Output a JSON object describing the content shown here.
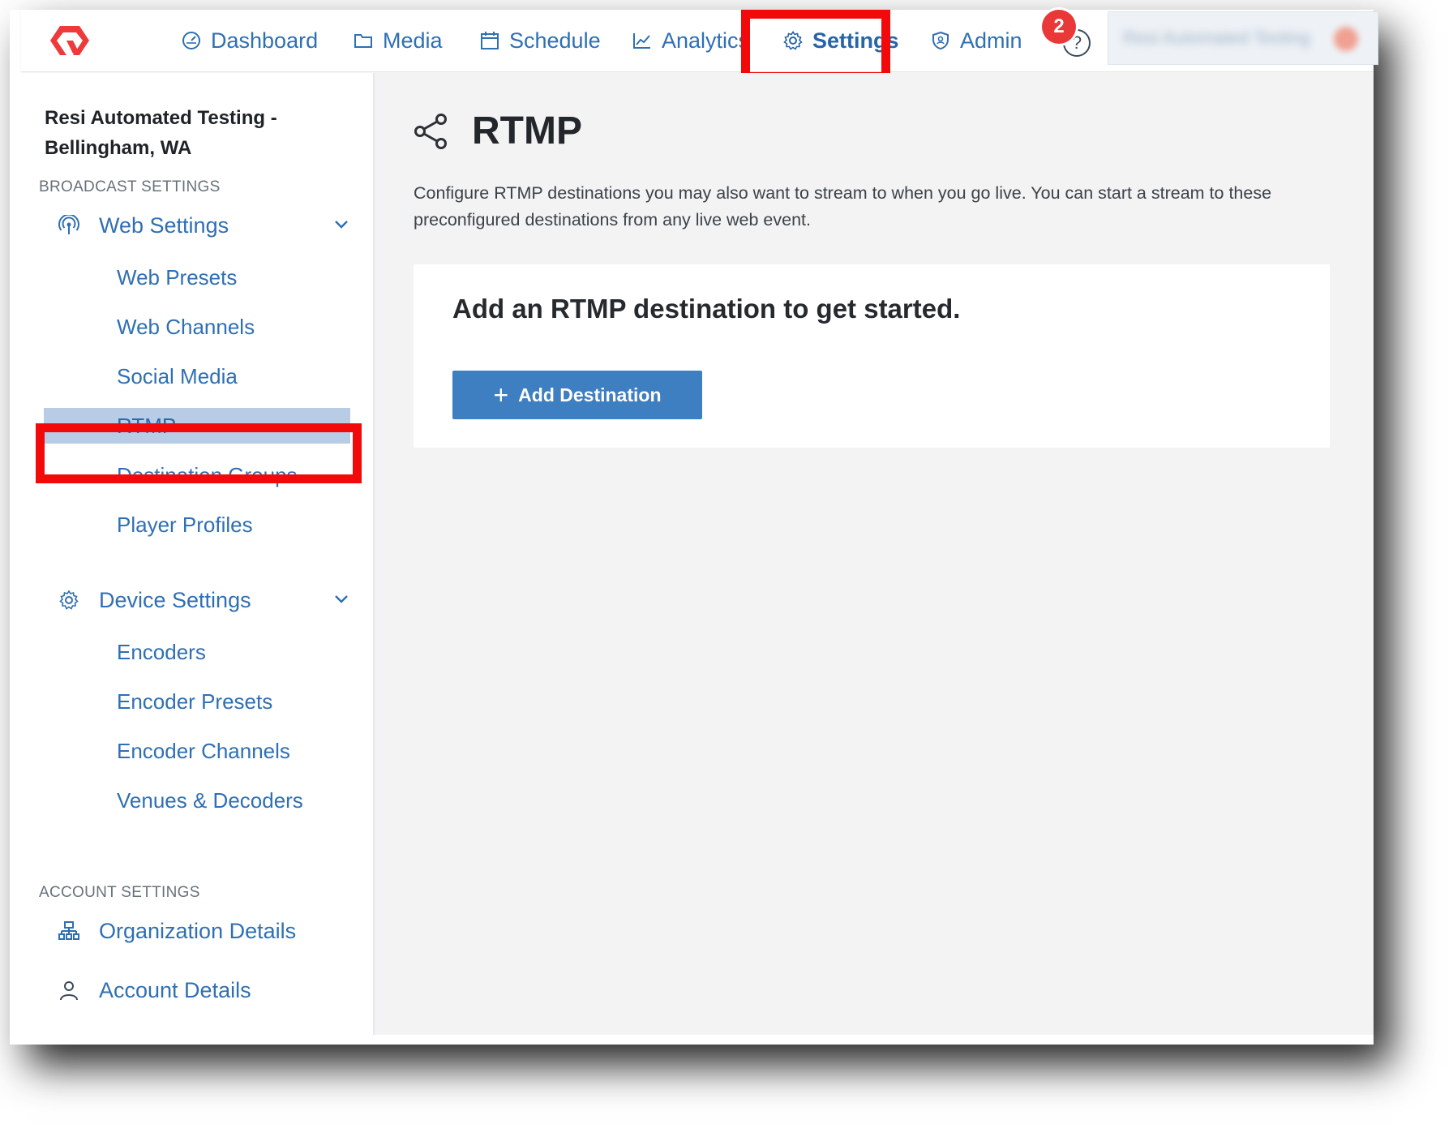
{
  "nav": {
    "items": [
      {
        "label": "Dashboard",
        "icon": "dashboard-gauge-icon"
      },
      {
        "label": "Media",
        "icon": "folder-icon"
      },
      {
        "label": "Schedule",
        "icon": "calendar-icon"
      },
      {
        "label": "Analytics",
        "icon": "line-chart-icon"
      },
      {
        "label": "Settings",
        "icon": "gear-icon"
      },
      {
        "label": "Admin",
        "icon": "shield-icon"
      }
    ],
    "active": "Settings",
    "notification_count": "2",
    "help_symbol": "?",
    "account_name": "Resi Automated Testing"
  },
  "sidebar": {
    "org_line1": "Resi Automated Testing -",
    "org_line2": "Bellingham, WA",
    "broadcast_label": "BROADCAST SETTINGS",
    "web_settings": {
      "label": "Web Settings",
      "items": [
        "Web Presets",
        "Web Channels",
        "Social Media",
        "RTMP",
        "Destination Groups",
        "Player Profiles"
      ]
    },
    "device_settings": {
      "label": "Device Settings",
      "items": [
        "Encoders",
        "Encoder Presets",
        "Encoder Channels",
        "Venues & Decoders"
      ]
    },
    "account_label": "ACCOUNT SETTINGS",
    "account_items": [
      "Organization Details",
      "Account Details"
    ],
    "selected": "RTMP"
  },
  "main": {
    "title": "RTMP",
    "description": "Configure RTMP destinations you may also want to stream to when you go live. You can start a stream to these preconfigured destinations from any live web event.",
    "card_heading": "Add an RTMP destination to get started.",
    "add_button": "Add Destination"
  },
  "colors": {
    "accent": "#2f6fb3",
    "button": "#3d7fc1",
    "highlight_annotation": "#f20a0a",
    "badge": "#ea3838",
    "selected_row": "#b8cde5"
  }
}
